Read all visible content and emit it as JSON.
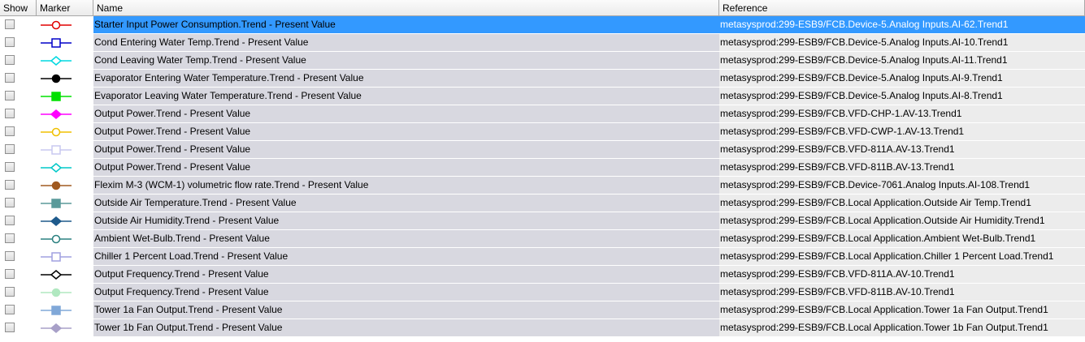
{
  "headers": {
    "show": "Show",
    "marker": "Marker",
    "name": "Name",
    "reference": "Reference"
  },
  "selected_row": 0,
  "rows": [
    {
      "name": "Starter Input Power Consumption.Trend - Present Value",
      "reference": "metasysprod:299-ESB9/FCB.Device-5.Analog Inputs.AI-62.Trend1",
      "marker": {
        "shape": "circle",
        "fill": "none",
        "color": "#e00000"
      }
    },
    {
      "name": "Cond Entering Water Temp.Trend - Present Value",
      "reference": "metasysprod:299-ESB9/FCB.Device-5.Analog Inputs.AI-10.Trend1",
      "marker": {
        "shape": "square",
        "fill": "none",
        "color": "#0000c8"
      }
    },
    {
      "name": "Cond Leaving Water Temp.Trend - Present Value",
      "reference": "metasysprod:299-ESB9/FCB.Device-5.Analog Inputs.AI-11.Trend1",
      "marker": {
        "shape": "diamond",
        "fill": "none",
        "color": "#00d8e0"
      }
    },
    {
      "name": "Evaporator Entering Water Temperature.Trend - Present Value",
      "reference": "metasysprod:299-ESB9/FCB.Device-5.Analog Inputs.AI-9.Trend1",
      "marker": {
        "shape": "circle",
        "fill": "solid",
        "color": "#000000"
      }
    },
    {
      "name": "Evaporator Leaving Water Temperature.Trend - Present Value",
      "reference": "metasysprod:299-ESB9/FCB.Device-5.Analog Inputs.AI-8.Trend1",
      "marker": {
        "shape": "square",
        "fill": "solid",
        "color": "#00e000"
      }
    },
    {
      "name": "Output Power.Trend - Present Value",
      "reference": "metasysprod:299-ESB9/FCB.VFD-CHP-1.AV-13.Trend1",
      "marker": {
        "shape": "diamond",
        "fill": "solid",
        "color": "#ff00ff"
      }
    },
    {
      "name": "Output Power.Trend - Present Value",
      "reference": "metasysprod:299-ESB9/FCB.VFD-CWP-1.AV-13.Trend1",
      "marker": {
        "shape": "circle",
        "fill": "none",
        "color": "#f0c000"
      }
    },
    {
      "name": "Output Power.Trend - Present Value",
      "reference": "metasysprod:299-ESB9/FCB.VFD-811A.AV-13.Trend1",
      "marker": {
        "shape": "square",
        "fill": "none",
        "color": "#c8c8f0"
      }
    },
    {
      "name": "Output Power.Trend - Present Value",
      "reference": "metasysprod:299-ESB9/FCB.VFD-811B.AV-13.Trend1",
      "marker": {
        "shape": "diamond",
        "fill": "none",
        "color": "#00c8c8"
      }
    },
    {
      "name": "Flexim M-3 (WCM-1) volumetric flow rate.Trend - Present Value",
      "reference": "metasysprod:299-ESB9/FCB.Device-7061.Analog Inputs.AI-108.Trend1",
      "marker": {
        "shape": "circle",
        "fill": "solid",
        "color": "#a05a20"
      }
    },
    {
      "name": "Outside Air Temperature.Trend - Present Value",
      "reference": "metasysprod:299-ESB9/FCB.Local Application.Outside Air Temp.Trend1",
      "marker": {
        "shape": "square",
        "fill": "solid",
        "color": "#5a9a9a"
      }
    },
    {
      "name": "Outside Air Humidity.Trend - Present Value",
      "reference": "metasysprod:299-ESB9/FCB.Local Application.Outside Air Humidity.Trend1",
      "marker": {
        "shape": "diamond",
        "fill": "solid",
        "color": "#1e5a8c"
      }
    },
    {
      "name": "Ambient Wet-Bulb.Trend - Present Value",
      "reference": "metasysprod:299-ESB9/FCB.Local Application.Ambient Wet-Bulb.Trend1",
      "marker": {
        "shape": "circle",
        "fill": "none",
        "color": "#2a8080"
      }
    },
    {
      "name": "Chiller 1 Percent Load.Trend - Present Value",
      "reference": "metasysprod:299-ESB9/FCB.Local Application.Chiller 1 Percent Load.Trend1",
      "marker": {
        "shape": "square",
        "fill": "none",
        "color": "#a0a0e0"
      }
    },
    {
      "name": "Output Frequency.Trend - Present Value",
      "reference": "metasysprod:299-ESB9/FCB.VFD-811A.AV-10.Trend1",
      "marker": {
        "shape": "diamond",
        "fill": "none",
        "color": "#000000"
      }
    },
    {
      "name": "Output Frequency.Trend - Present Value",
      "reference": "metasysprod:299-ESB9/FCB.VFD-811B.AV-10.Trend1",
      "marker": {
        "shape": "circle",
        "fill": "solid",
        "color": "#b0e8c0"
      }
    },
    {
      "name": "Tower 1a Fan Output.Trend - Present Value",
      "reference": "metasysprod:299-ESB9/FCB.Local Application.Tower 1a Fan Output.Trend1",
      "marker": {
        "shape": "square",
        "fill": "solid",
        "color": "#80a8d8"
      }
    },
    {
      "name": "Tower 1b Fan Output.Trend - Present Value",
      "reference": "metasysprod:299-ESB9/FCB.Local Application.Tower 1b Fan Output.Trend1",
      "marker": {
        "shape": "diamond",
        "fill": "solid",
        "color": "#a8a0c8"
      }
    }
  ]
}
